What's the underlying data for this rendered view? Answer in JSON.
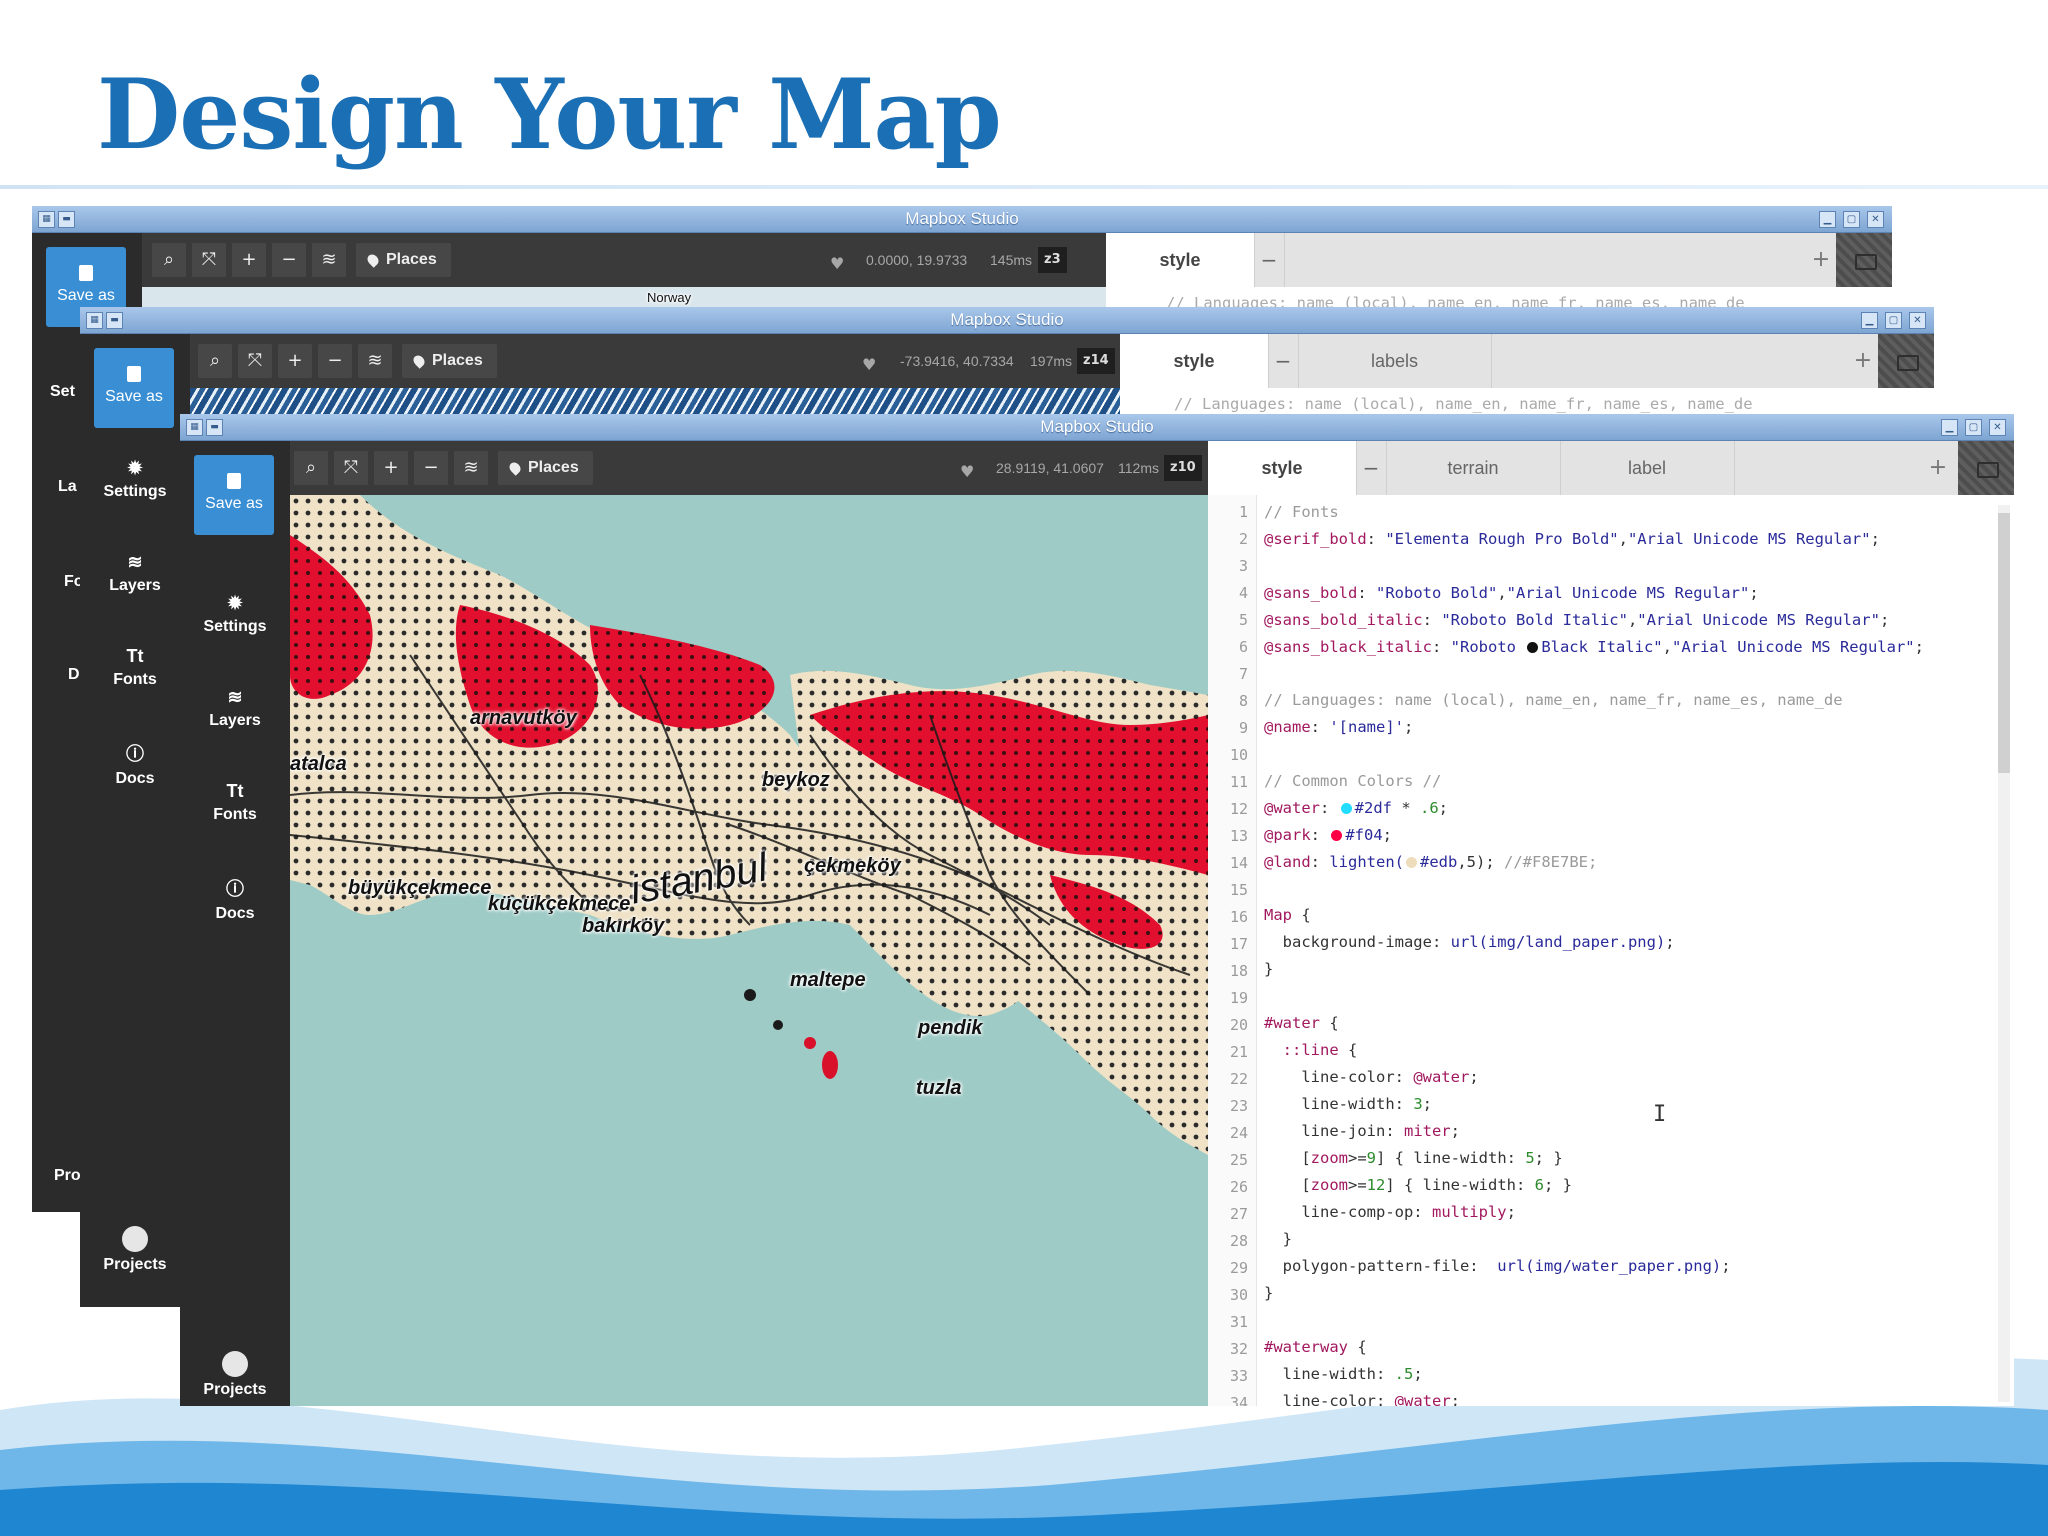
{
  "slide": {
    "title": "Design Your Map"
  },
  "app": {
    "window_title": "Mapbox Studio",
    "save_label": "Save as",
    "places_label": "Places",
    "settings": "Settings",
    "layers": "Layers",
    "fonts": "Fonts",
    "docs": "Docs",
    "projects": "Projects",
    "tab_style": "style",
    "tab_add": "+",
    "tab_minus": "−"
  },
  "win1": {
    "coords": "0.0000, 19.9733",
    "timing": "145ms",
    "zoom": "z3",
    "map_label": "Norway",
    "code_line": "// Languages: name (local), name_en, name_fr, name_es, name_de",
    "sidebar_partial": {
      "settings": "Set",
      "layers": "La",
      "fonts": "Fo",
      "docs": "D",
      "projects": "Pro"
    }
  },
  "win2": {
    "coords": "-73.9416, 40.7334",
    "timing": "197ms",
    "zoom": "z14",
    "tab2": "labels",
    "code_line": "// Languages: name (local), name_en, name_fr, name_es, name_de"
  },
  "win3": {
    "coords": "28.9119, 41.0607",
    "timing": "112ms",
    "zoom": "z10",
    "tab2": "terrain",
    "tab3": "label",
    "map_labels": [
      "arnavutköy",
      "atalca",
      "beykoz",
      "çekmeköy",
      "büyükçekmece",
      "küçükçekmece",
      "istanbul",
      "bakırköy",
      "maltepe",
      "pendik",
      "tuzla"
    ]
  },
  "code": {
    "l1": "// Fonts",
    "l2a": "@serif_bold",
    "l2b": "\"Elementa Rough Pro Bold\"",
    "l2c": "\"Arial Unicode MS Regular\"",
    "l4a": "@sans_bold",
    "l4b": "\"Roboto Bold\"",
    "l4c": "\"Arial Unicode MS Regular\"",
    "l5a": "@sans_bold_italic",
    "l5b": "\"Roboto Bold Italic\"",
    "l5c": "\"Arial Unicode MS Regular\"",
    "l6a": "@sans_black_italic",
    "l6b": "\"Roboto ",
    "l6c": "Black Italic\"",
    "l6d": "\"Arial Unicode MS Regular\"",
    "l8": "// Languages: name (local), name_en, name_fr, name_es, name_de",
    "l9a": "@name",
    "l9b": "'[name]'",
    "l11": "// Common Colors //",
    "l12a": "@water",
    "l12b": "#2df",
    "l12c": " * ",
    "l12d": ".6",
    "l13a": "@park",
    "l13b": "#f04",
    "l14a": "@land",
    "l14b": " lighten(",
    "l14c": "#edb",
    "l14d": ",5); ",
    "l14e": "//#F8E7BE;",
    "l16a": "Map",
    "l16b": " {",
    "l17a": "  background-image: ",
    "l17b": "url(img/land_paper.png)",
    "l17c": ";",
    "l18": "}",
    "l20a": "#water",
    "l20b": " {",
    "l21a": "  ",
    "l21b": "::line",
    "l21c": " {",
    "l22a": "    line-color: ",
    "l22b": "@water",
    "l22c": ";",
    "l23a": "    line-width: ",
    "l23b": "3",
    "l23c": ";",
    "l24a": "    line-join: ",
    "l24b": "miter",
    "l24c": ";",
    "l25a": "    [",
    "l25b": "zoom",
    "l25c": ">=",
    "l25d": "9",
    "l25e": "] { line-width: ",
    "l25f": "5",
    "l25g": "; }",
    "l26a": "    [",
    "l26b": "zoom",
    "l26c": ">=",
    "l26d": "12",
    "l26e": "] { line-width: ",
    "l26f": "6",
    "l26g": "; }",
    "l27a": "    line-comp-op: ",
    "l27b": "multiply",
    "l27c": ";",
    "l28": "  }",
    "l29a": "  polygon-pattern-file:  ",
    "l29b": "url(img/water_paper.png)",
    "l29c": ";",
    "l30": "}",
    "l32a": "#waterway",
    "l32b": " {",
    "l33a": "  line-width: ",
    "l33b": ".5",
    "l33c": ";",
    "l34a": "  line-color: ",
    "l34b": "@water",
    "l34c": ";"
  },
  "line_numbers": [
    "1",
    "2",
    "3",
    "4",
    "5",
    "6",
    "7",
    "8",
    "9",
    "10",
    "11",
    "12",
    "13",
    "14",
    "15",
    "16",
    "17",
    "18",
    "19",
    "20",
    "21",
    "22",
    "23",
    "24",
    "25",
    "26",
    "27",
    "28",
    "29",
    "30",
    "31",
    "32",
    "33",
    "34"
  ],
  "colors": {
    "water": "#22ddff",
    "park": "#ff0044",
    "land": "#eeddbb",
    "accent": "#3a8fd4",
    "title": "#1b6fb5"
  }
}
